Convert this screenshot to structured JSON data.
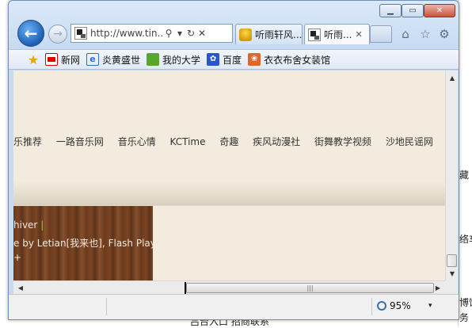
{
  "background_page": {
    "right_texts": [
      "藏",
      "络车",
      "博饼",
      "务"
    ],
    "bottom_text": "吕台入口 招商联系"
  },
  "window": {
    "minimize_label": "▁",
    "maximize_label": "▭",
    "close_label": "✕"
  },
  "nav": {
    "back_label": "←",
    "forward_label": "→",
    "address_url": "http://www.tin...",
    "search_icon": "⚲",
    "dropdown_icon": "▾",
    "refresh_icon": "↻",
    "stop_icon": "✕"
  },
  "tabs": [
    {
      "title": "听雨轩风...",
      "icon": "trophy-icon"
    },
    {
      "title": "听雨...",
      "icon": "site-favicon",
      "close": "✕"
    }
  ],
  "toolbar_icons": {
    "home": "⌂",
    "favorites": "☆",
    "tools": "⚙"
  },
  "favorites_bar": {
    "items": [
      {
        "label": "新网",
        "icon": "sina-icon"
      },
      {
        "label": "炎黄盛世",
        "icon": "ie-icon"
      },
      {
        "label": "我的大学",
        "icon": "chat-icon"
      },
      {
        "label": "百度",
        "icon": "baidu-icon"
      },
      {
        "label": "衣衣布舍女装馆",
        "icon": "shop-icon"
      }
    ]
  },
  "content": {
    "nav_links": [
      "乐推荐",
      "一路音乐网",
      "音乐心情",
      "KCTime",
      "奇趣",
      "疾风动漫社",
      "街舞教学视频",
      "沙地民谣网"
    ],
    "wood_lines": [
      "hiver",
      "|",
      "e by Letian[我来也], Flash Player",
      "+"
    ]
  },
  "statusbar": {
    "zoom": "95%",
    "zoom_dropdown": "▾"
  }
}
